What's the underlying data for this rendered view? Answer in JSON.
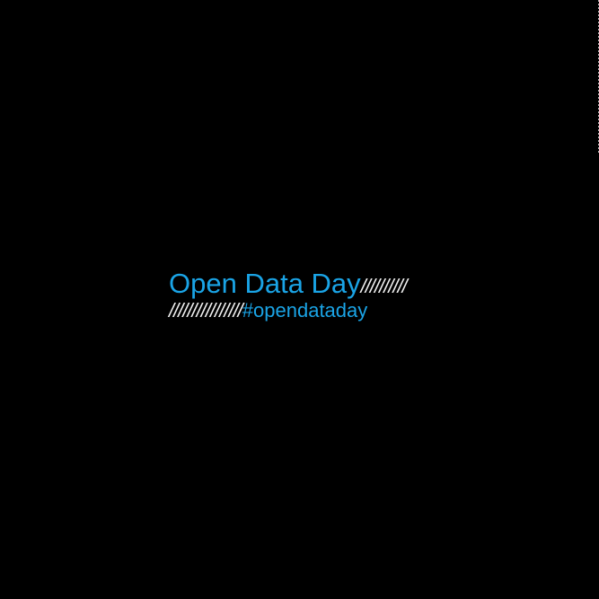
{
  "title": "Open Data Day",
  "title_slashes": "//////////",
  "hashtag_slashes": "////////////////",
  "hashtag": "#opendataday",
  "colors": {
    "background": "#000000",
    "accent": "#1aa4e6",
    "slashes": "#f2f2f2"
  }
}
